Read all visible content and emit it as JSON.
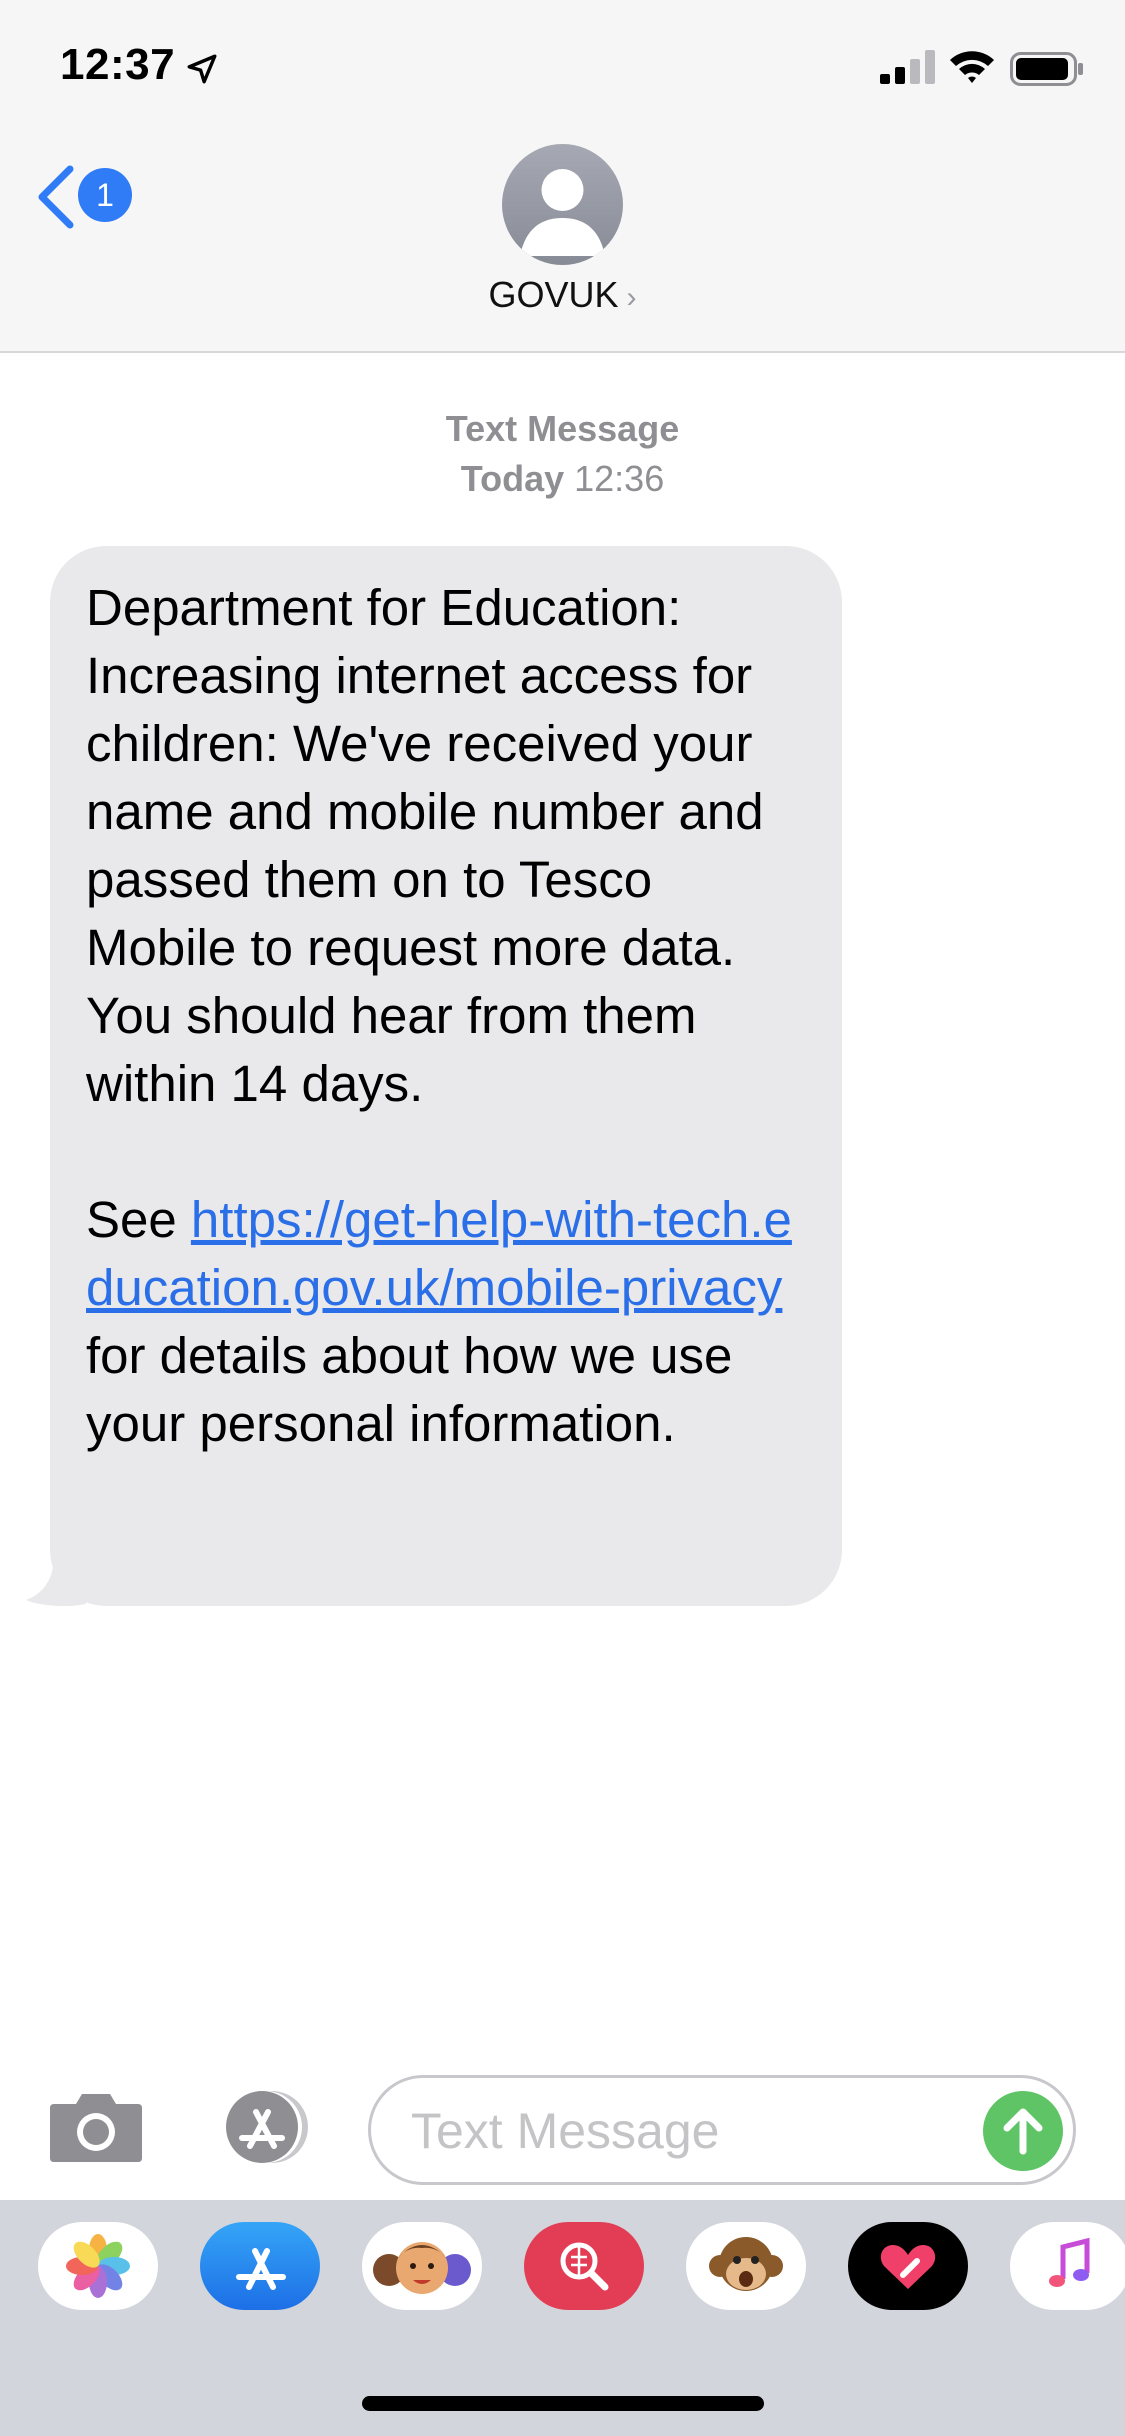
{
  "status_bar": {
    "time": "12:37"
  },
  "header": {
    "back_badge_count": "1",
    "contact_name": "GOVUK",
    "contact_chevron": "›"
  },
  "thread": {
    "meta_type": "Text Message",
    "meta_day": "Today",
    "meta_time": "12:36",
    "message": {
      "paragraph1": "Department for Education: Increasing internet access for children: We've received your name and mobile number and passed them on to Tesco Mobile to request more data. You should hear from them within 14 days.",
      "prefix": "See ",
      "link": "https://get-help-with-tech.education.gov.uk/mobile-privacy",
      "suffix": " for details about how we use your personal information."
    }
  },
  "composer": {
    "placeholder": "Text Message"
  },
  "app_drawer": {
    "apps": [
      "photos-icon",
      "app-store-icon",
      "memoji-icon",
      "web-search-icon",
      "monkey-animoji-icon",
      "digital-touch-icon",
      "music-icon"
    ]
  },
  "colors": {
    "link": "#2a6ee8",
    "bubble": "#e9e9eb",
    "send": "#5fc466",
    "badge": "#2f7cf6"
  }
}
